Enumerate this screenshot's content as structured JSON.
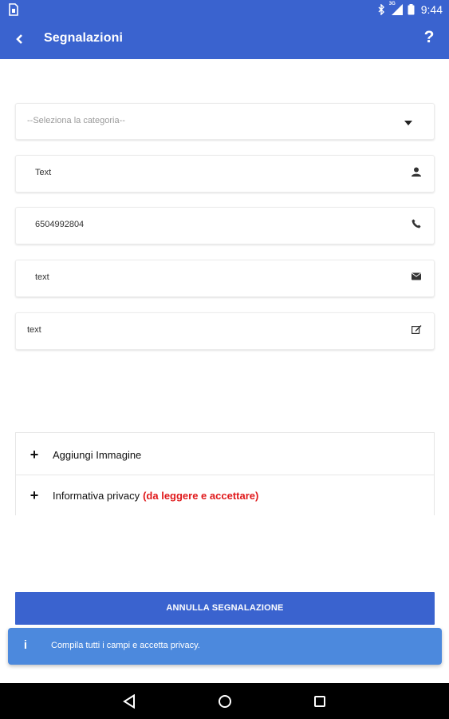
{
  "status_bar": {
    "time": "9:44",
    "network": "3G",
    "icons": [
      "sim-icon",
      "bluetooth-icon",
      "signal-icon",
      "battery-icon"
    ]
  },
  "app_bar": {
    "title": "Segnalazioni",
    "help": "?",
    "icons": [
      "back-arrow-icon"
    ]
  },
  "form": {
    "category": {
      "value": "--Seleziona la categoria--",
      "icon": "dropdown-arrow-icon"
    },
    "name": {
      "value": "Text",
      "icon": "person-icon"
    },
    "phone": {
      "value": "6504992804",
      "icon": "phone-icon"
    },
    "email": {
      "value": "text",
      "icon": "envelope-icon"
    },
    "note": {
      "value": "text",
      "icon": "edit-icon"
    }
  },
  "accordion": {
    "items": [
      {
        "symbol": "+",
        "label": "Aggiungi Immagine"
      },
      {
        "symbol": "+",
        "label": "Informativa privacy",
        "highlight": "(da leggere e accettare)"
      }
    ]
  },
  "cancel_button": {
    "label": "ANNULLA SEGNALAZIONE"
  },
  "toast": {
    "icon": "i",
    "message": "Compila tutti i campi e accetta privacy."
  },
  "nav_bar": {
    "icons": [
      "back-triangle-icon",
      "home-circle-icon",
      "recents-square-icon"
    ]
  },
  "colors": {
    "primary": "#3a63cf",
    "toast": "#4c89dd",
    "warning_text": "#e0191b",
    "nav_bar": "#000000"
  }
}
